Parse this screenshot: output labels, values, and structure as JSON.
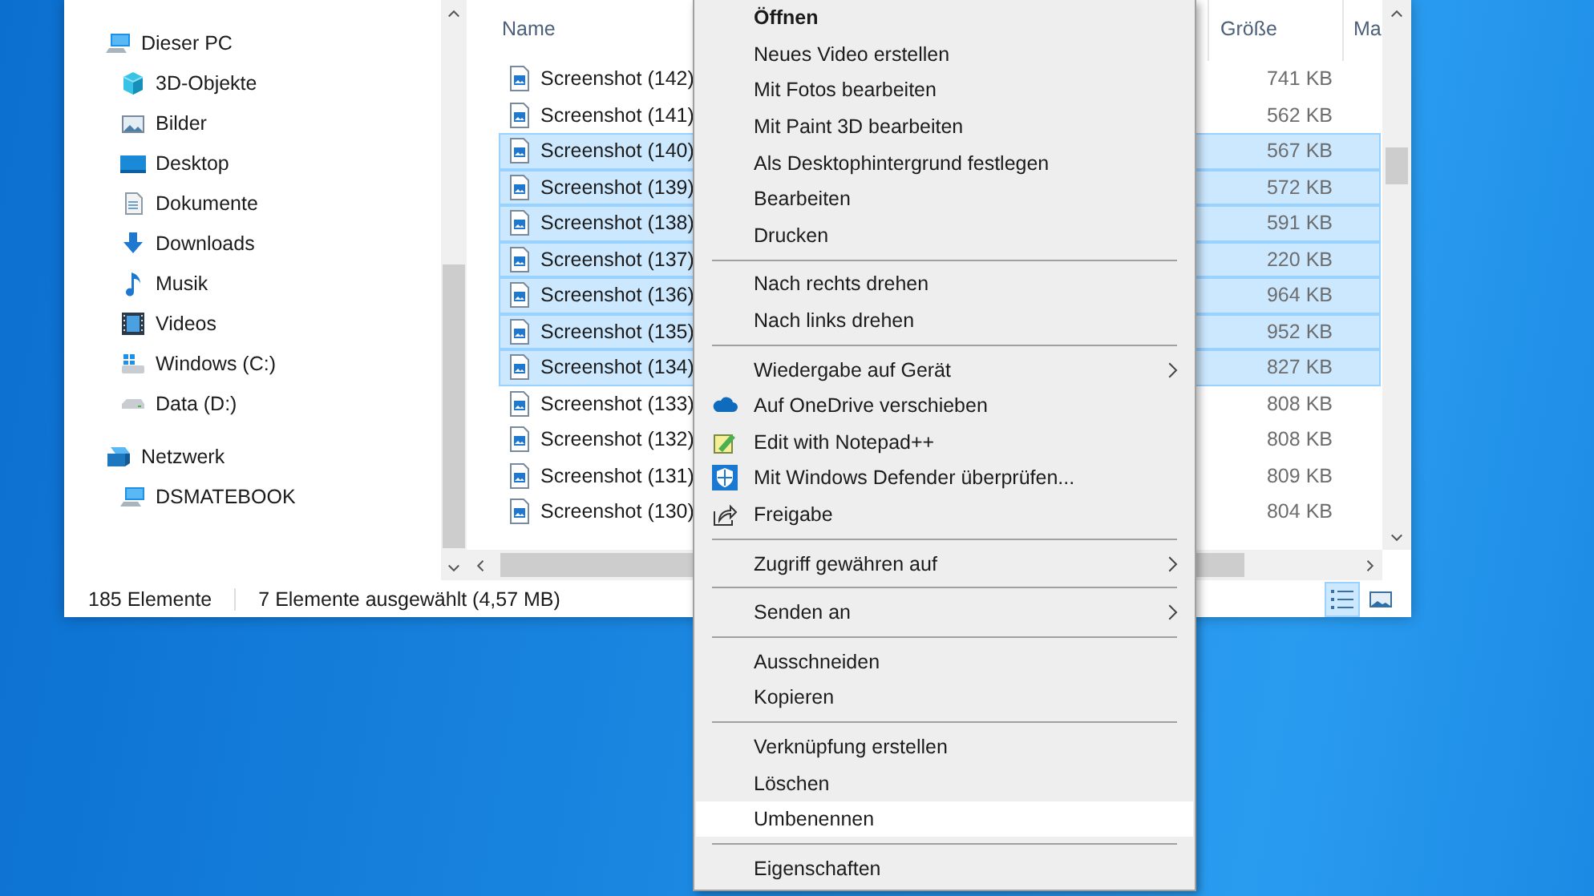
{
  "explorer": {
    "nav": [
      {
        "label": "Dieser PC",
        "kind": "pc",
        "children": [
          {
            "label": "3D-Objekte",
            "kind": "cube"
          },
          {
            "label": "Bilder",
            "kind": "pictures"
          },
          {
            "label": "Desktop",
            "kind": "desktop"
          },
          {
            "label": "Dokumente",
            "kind": "documents"
          },
          {
            "label": "Downloads",
            "kind": "download"
          },
          {
            "label": "Musik",
            "kind": "music"
          },
          {
            "label": "Videos",
            "kind": "videos"
          },
          {
            "label": "Windows (C:)",
            "kind": "windrive"
          },
          {
            "label": "Data (D:)",
            "kind": "drive"
          }
        ]
      },
      {
        "label": "Netzwerk",
        "kind": "network",
        "children": [
          {
            "label": "DSMATEBOOK",
            "kind": "pc"
          }
        ]
      }
    ],
    "columns": [
      "Name",
      "Größe",
      "Ma"
    ],
    "files": [
      {
        "name": "Screenshot (142)",
        "size": "741 KB",
        "selected": false
      },
      {
        "name": "Screenshot (141)",
        "size": "562 KB",
        "selected": false
      },
      {
        "name": "Screenshot (140)",
        "size": "567 KB",
        "selected": true
      },
      {
        "name": "Screenshot (139)",
        "size": "572 KB",
        "selected": true
      },
      {
        "name": "Screenshot (138)",
        "size": "591 KB",
        "selected": true
      },
      {
        "name": "Screenshot (137)",
        "size": "220 KB",
        "selected": true
      },
      {
        "name": "Screenshot (136)",
        "size": "964 KB",
        "selected": true
      },
      {
        "name": "Screenshot (135)",
        "size": "952 KB",
        "selected": true
      },
      {
        "name": "Screenshot (134)",
        "size": "827 KB",
        "selected": true
      },
      {
        "name": "Screenshot (133)",
        "size": "808 KB",
        "selected": false
      },
      {
        "name": "Screenshot (132)",
        "size": "808 KB",
        "selected": false
      },
      {
        "name": "Screenshot (131)",
        "size": "809 KB",
        "selected": false
      },
      {
        "name": "Screenshot (130)",
        "size": "804 KB",
        "selected": false
      }
    ],
    "status_bar": {
      "item_count": "185 Elemente",
      "selection": "7 Elemente ausgewählt (4,57 MB)",
      "view_buttons": [
        {
          "kind": "details",
          "selected": true
        },
        {
          "kind": "thumbnails",
          "selected": false
        }
      ]
    }
  },
  "context_menu": {
    "groups": [
      {
        "items": [
          {
            "label": "Öffnen",
            "default": true,
            "submenu": false,
            "selected": false
          },
          {
            "label": "Neues Video erstellen",
            "default": false,
            "submenu": false,
            "selected": false
          },
          {
            "label": "Mit Fotos bearbeiten",
            "default": false,
            "submenu": false,
            "selected": false
          },
          {
            "label": "Mit Paint 3D bearbeiten",
            "default": false,
            "submenu": false,
            "selected": false
          },
          {
            "label": "Als Desktophintergrund festlegen",
            "default": false,
            "submenu": false,
            "selected": false
          },
          {
            "label": "Bearbeiten",
            "default": false,
            "submenu": false,
            "selected": false
          },
          {
            "label": "Drucken",
            "default": false,
            "submenu": false,
            "selected": false
          }
        ]
      },
      {
        "items": [
          {
            "label": "Nach rechts drehen",
            "default": false,
            "submenu": false,
            "selected": false
          },
          {
            "label": "Nach links drehen",
            "default": false,
            "submenu": false,
            "selected": false
          }
        ]
      },
      {
        "items": [
          {
            "label": "Wiedergabe auf Gerät",
            "default": false,
            "submenu": true,
            "selected": false
          },
          {
            "label": "Auf OneDrive verschieben",
            "kind": "cloud",
            "default": false,
            "submenu": false,
            "selected": false
          },
          {
            "label": "Edit with Notepad++",
            "kind": "notepad",
            "default": false,
            "submenu": false,
            "selected": false
          },
          {
            "label": "Mit Windows Defender überprüfen...",
            "kind": "shield",
            "default": false,
            "submenu": false,
            "selected": false
          },
          {
            "label": "Freigabe",
            "kind": "share",
            "default": false,
            "submenu": false,
            "selected": false
          }
        ]
      },
      {
        "items": [
          {
            "label": "Zugriff gewähren auf",
            "default": false,
            "submenu": true,
            "selected": false
          }
        ]
      },
      {
        "items": [
          {
            "label": "Senden an",
            "default": false,
            "submenu": true,
            "selected": false
          }
        ]
      },
      {
        "items": [
          {
            "label": "Ausschneiden",
            "default": false,
            "submenu": false,
            "selected": false
          },
          {
            "label": "Kopieren",
            "default": false,
            "submenu": false,
            "selected": false
          }
        ]
      },
      {
        "items": [
          {
            "label": "Verknüpfung erstellen",
            "default": false,
            "submenu": false,
            "selected": false
          },
          {
            "label": "Löschen",
            "default": false,
            "submenu": false,
            "selected": false
          },
          {
            "label": "Umbenennen",
            "default": false,
            "submenu": false,
            "selected": true
          }
        ]
      },
      {
        "items": [
          {
            "label": "Eigenschaften",
            "default": false,
            "submenu": false,
            "selected": false
          }
        ]
      }
    ]
  }
}
